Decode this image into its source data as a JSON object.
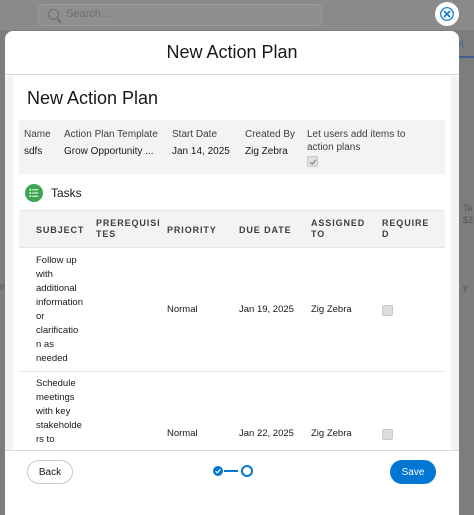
{
  "background": {
    "search_placeholder": "Search...",
    "right_tab": "Vi",
    "right_text_1": "Ta",
    "right_text_2": "$2",
    "right_text_3": "y",
    "left_text": "rl"
  },
  "modal": {
    "title": "New Action Plan",
    "card_title": "New Action Plan",
    "info": {
      "name_label": "Name",
      "name_value": "sdfs",
      "template_label": "Action Plan Template",
      "template_value": "Grow Opportunity ...",
      "start_label": "Start Date",
      "start_value": "Jan 14, 2025",
      "created_label": "Created By",
      "created_value": "Zig Zebra",
      "allow_label": "Let users add items to action plans",
      "allow_checked": true
    },
    "tasks": {
      "title": "Tasks",
      "columns": {
        "subject_line1": "SUBJECT",
        "prereq_line1": "PREREQUISI",
        "prereq_line2": "TES",
        "priority": "PRIORITY",
        "due_date": "DUE DATE",
        "assigned_line1": "ASSIGNED",
        "assigned_line2": "TO",
        "required_line1": "REQUIRE",
        "required_line2": "D"
      },
      "rows": [
        {
          "subject_lines": [
            "Follow up",
            "with",
            "additional",
            "information",
            "or",
            "clarificatio",
            "n as",
            "needed"
          ],
          "priority": "Normal",
          "due_date": "Jan 19, 2025",
          "assigned_to": "Zig Zebra",
          "required": false
        },
        {
          "subject_lines": [
            "Schedule",
            "meetings",
            "with key",
            "stakeholde",
            "rs to"
          ],
          "priority": "Normal",
          "due_date": "Jan 22, 2025",
          "assigned_to": "Zig Zebra",
          "required": false
        }
      ]
    },
    "footer": {
      "back_label": "Back",
      "save_label": "Save",
      "current_step": 2,
      "total_steps": 2
    }
  },
  "colors": {
    "brand": "#0176d3",
    "tasks_icon": "#3ba755"
  }
}
